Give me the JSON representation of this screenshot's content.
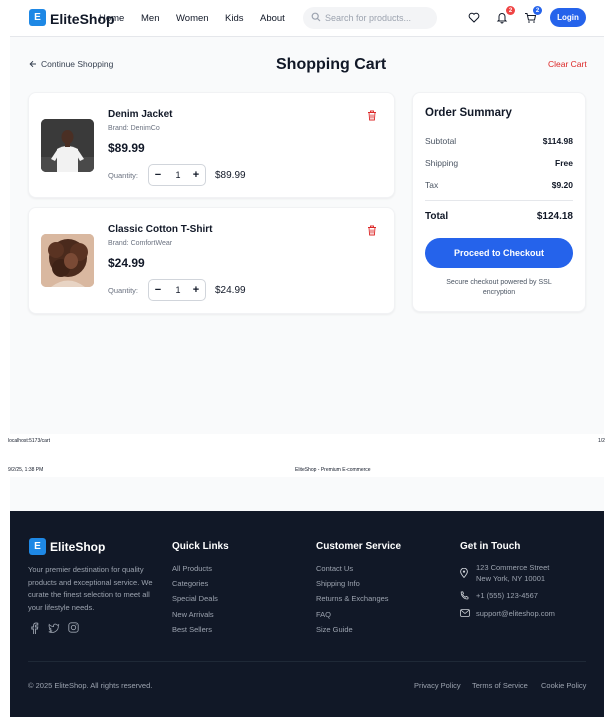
{
  "nav": {
    "logo_letter": "E",
    "brand": "EliteShop",
    "links": [
      "Home",
      "Men",
      "Women",
      "Kids",
      "About"
    ],
    "search_placeholder": "Search for products...",
    "notifications_count": "2",
    "cart_count": "2",
    "login_label": "Login",
    "accent_color": "#2563eb"
  },
  "cart": {
    "back_label": "Continue Shopping",
    "title": "Shopping Cart",
    "clear_label": "Clear Cart",
    "quantity_label": "Quantity:",
    "items": [
      {
        "name": "Denim Jacket",
        "brand": "Brand: DenimCo",
        "price": "$89.99",
        "quantity": "1",
        "line_total": "$89.99",
        "image_icon": "man-in-white-tshirt"
      },
      {
        "name": "Classic Cotton T-Shirt",
        "brand": "Brand: ComfortWear",
        "price": "$24.99",
        "quantity": "1",
        "line_total": "$24.99",
        "image_icon": "woman-with-curly-hair"
      }
    ]
  },
  "summary": {
    "title": "Order Summary",
    "subtotal_label": "Subtotal",
    "subtotal": "$114.98",
    "shipping_label": "Shipping",
    "shipping": "Free",
    "tax_label": "Tax",
    "tax": "$9.20",
    "total_label": "Total",
    "total": "$124.18",
    "checkout_label": "Proceed to Checkout",
    "secure_note": "Secure checkout powered by SSL encryption"
  },
  "print_header": {
    "url": "localhost:5173/cart",
    "page": "1/2",
    "datetime": "9/2/25, 1:38 PM",
    "doc_title": "EliteShop - Premium E-commerce"
  },
  "footer": {
    "logo_letter": "E",
    "brand": "EliteShop",
    "tagline": "Your premier destination for quality products and exceptional service. We curate the finest selection to meet all your lifestyle needs.",
    "social_icons": [
      "facebook-icon",
      "twitter-icon",
      "instagram-icon"
    ],
    "quick_links_title": "Quick Links",
    "quick_links": [
      "All Products",
      "Categories",
      "Special Deals",
      "New Arrivals",
      "Best Sellers"
    ],
    "service_title": "Customer Service",
    "service_links": [
      "Contact Us",
      "Shipping Info",
      "Returns & Exchanges",
      "FAQ",
      "Size Guide"
    ],
    "contact_title": "Get in Touch",
    "address_line1": "123 Commerce Street",
    "address_line2": "New York, NY 10001",
    "phone": "+1 (555) 123-4567",
    "email": "support@eliteshop.com",
    "copyright": "© 2025 EliteShop. All rights reserved.",
    "legal_links": [
      "Privacy Policy",
      "Terms of Service",
      "Cookie Policy"
    ]
  }
}
